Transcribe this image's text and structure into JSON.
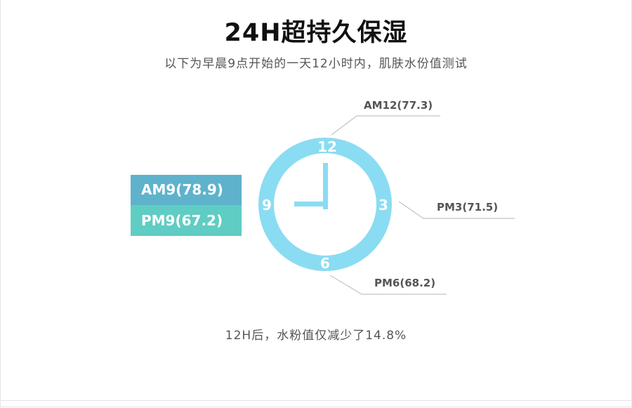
{
  "title": "24H超持久保湿",
  "subtitle": "以下为早晨9点开始的一天12小时内，肌肤水份值测试",
  "footer": "12H后，水粉值仅减少了14.8%",
  "legend": {
    "am": "AM9(78.9)",
    "pm": "PM9(67.2)"
  },
  "clock": {
    "numbers": {
      "twelve": "12",
      "three": "3",
      "six": "6",
      "nine": "9"
    }
  },
  "callouts": {
    "am12": "AM12(77.3)",
    "pm3": "PM3(71.5)",
    "pm6": "PM6(68.2)"
  },
  "colors": {
    "ring": "#8adcf2",
    "hands": "#8adcf2",
    "legend_am": "#5fb2cc",
    "legend_pm": "#5fcdc4",
    "leader": "#b5b5b5"
  },
  "chart_data": {
    "type": "table",
    "points": [
      {
        "label": "AM9",
        "value": 78.9
      },
      {
        "label": "AM12",
        "value": 77.3
      },
      {
        "label": "PM3",
        "value": 71.5
      },
      {
        "label": "PM6",
        "value": 68.2
      },
      {
        "label": "PM9",
        "value": 67.2
      }
    ]
  }
}
